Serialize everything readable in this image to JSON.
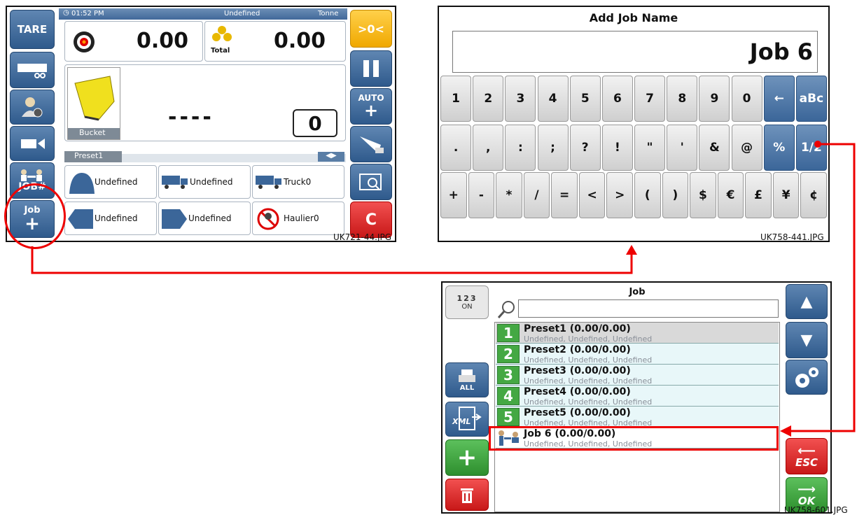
{
  "panel1": {
    "status": {
      "time": "01:52 PM",
      "job": "Undefined",
      "unit": "Tonne"
    },
    "left_buttons": {
      "tare": "TARE",
      "job_hash": "JOB#",
      "job_add": "Job"
    },
    "weights": {
      "current": "0.00",
      "total": "0.00",
      "total_label": "Total"
    },
    "bucket": {
      "label": "Bucket",
      "dashes": "----",
      "count": "0"
    },
    "preset_tab": "Preset1",
    "tiles": [
      {
        "label": "Undefined",
        "icon": "bucket-shape-icon"
      },
      {
        "label": "Undefined",
        "icon": "truck-icon"
      },
      {
        "label": "Truck0",
        "icon": "truck-icon"
      },
      {
        "label": "Undefined",
        "icon": "arrow-left-icon"
      },
      {
        "label": "Undefined",
        "icon": "arrow-right-icon"
      },
      {
        "label": "Haulier0",
        "icon": "haulier-icon"
      }
    ],
    "right_buttons": {
      "zero": ">0<",
      "auto": "AUTO",
      "clear": "C"
    },
    "filename": "UK721-44.JPG"
  },
  "panel2": {
    "title": "Add Job Name",
    "value": "Job 6",
    "rows": [
      [
        "1",
        "2",
        "3",
        "4",
        "5",
        "6",
        "7",
        "8",
        "9",
        "0",
        "←",
        "aBc"
      ],
      [
        ".",
        ",",
        ":",
        ";",
        "?",
        "!",
        "\"",
        "'",
        "&",
        "@",
        "%",
        "1/2"
      ],
      [
        "+",
        "-",
        "*",
        "/",
        "=",
        "<",
        ">",
        "(",
        ")",
        "$",
        "€",
        "£",
        "¥",
        "¢"
      ]
    ],
    "filename": "UK758-441.JPG"
  },
  "panel3": {
    "title": "Job",
    "toggle": {
      "digits": "123",
      "state": "ON"
    },
    "print_label": "ALL",
    "xml_label": "XML",
    "search_placeholder": "",
    "rows": [
      {
        "num": "1",
        "title": "Preset1 (0.00/0.00)",
        "sub": "Undefined, Undefined, Undefined"
      },
      {
        "num": "2",
        "title": "Preset2 (0.00/0.00)",
        "sub": "Undefined, Undefined, Undefined"
      },
      {
        "num": "3",
        "title": "Preset3 (0.00/0.00)",
        "sub": "Undefined, Undefined, Undefined"
      },
      {
        "num": "4",
        "title": "Preset4 (0.00/0.00)",
        "sub": "Undefined, Undefined, Undefined"
      },
      {
        "num": "5",
        "title": "Preset5 (0.00/0.00)",
        "sub": "Undefined, Undefined, Undefined"
      },
      {
        "num": "",
        "title": "Job 6 (0.00/0.00)",
        "sub": "Undefined, Undefined, Undefined"
      }
    ],
    "esc": "ESC",
    "ok": "OK",
    "filename": "UK758-601.JPG"
  },
  "colors": {
    "highlight": "#e00000",
    "blue_button": "#3b6699",
    "green": "#44a843",
    "yellow": "#f5b81c"
  }
}
